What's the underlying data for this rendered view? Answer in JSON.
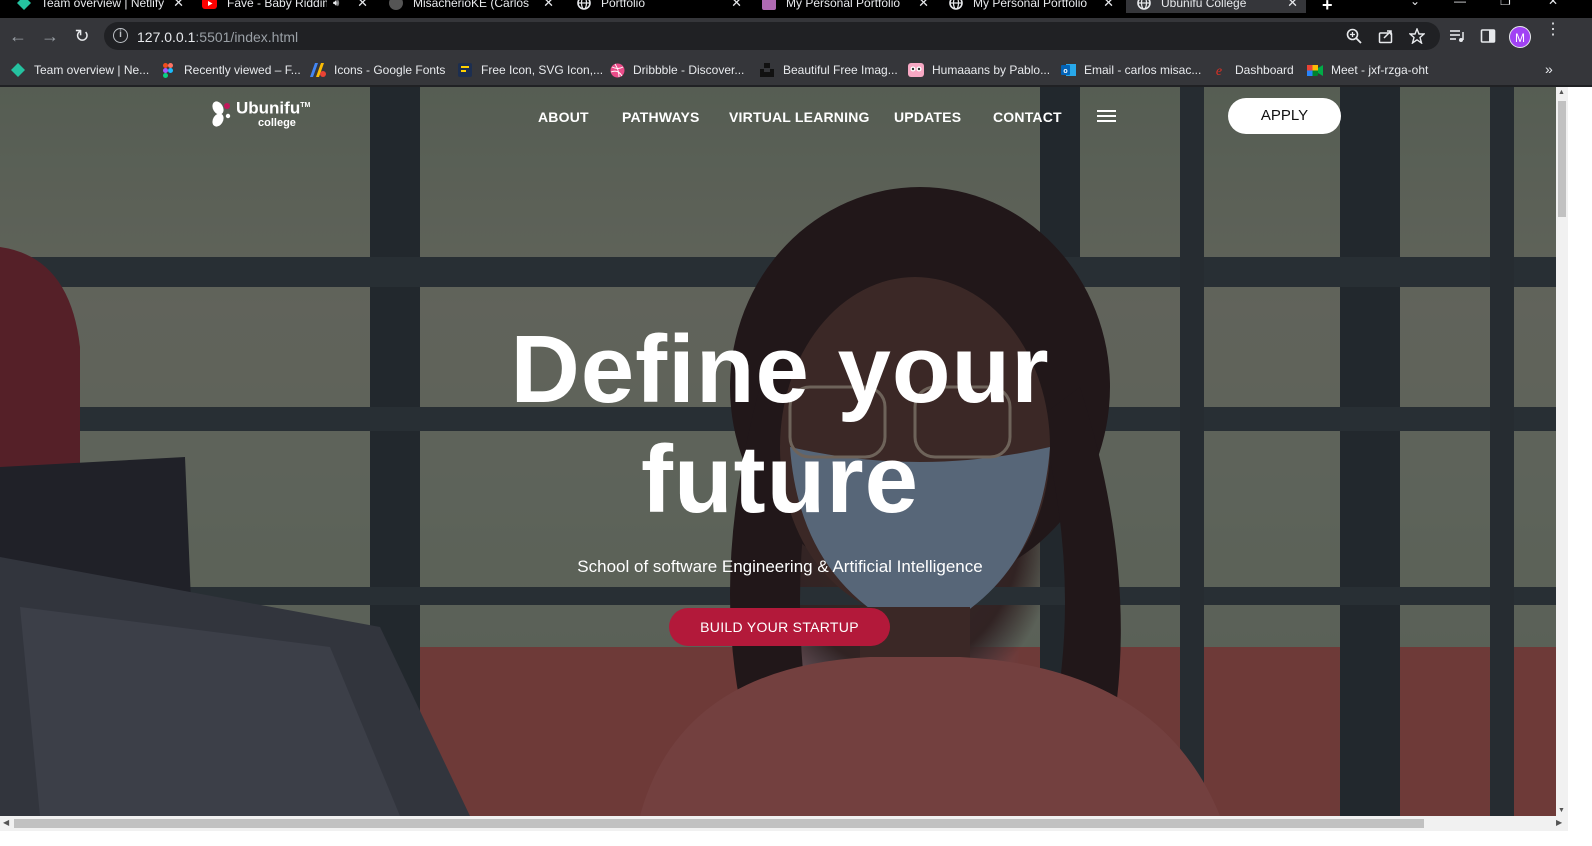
{
  "browser": {
    "tabs": [
      {
        "title": "Team overview | Netlify",
        "favicon": "netlify-icon"
      },
      {
        "title": "Fave - Baby Riddim",
        "favicon": "youtube-icon"
      },
      {
        "title": "MisacherioKE (Carlos M",
        "favicon": "github-icon"
      },
      {
        "title": "Portfolio",
        "favicon": "globe-icon"
      },
      {
        "title": "My Personal Portfolio",
        "favicon": "portfolio-icon"
      },
      {
        "title": "My Personal Portfolio",
        "favicon": "globe-icon"
      },
      {
        "title": "Ubunifu College",
        "favicon": "globe-icon",
        "active": true
      }
    ],
    "url_host": "127.0.0.1",
    "url_rest": ":5501/index.html",
    "profile_initial": "M",
    "bookmarks": [
      {
        "label": "Team overview | Ne...",
        "favicon": "netlify-icon"
      },
      {
        "label": "Recently viewed – F...",
        "favicon": "figma-icon"
      },
      {
        "label": "Icons - Google Fonts",
        "favicon": "google-fonts-icon"
      },
      {
        "label": "Free Icon, SVG Icon,...",
        "favicon": "flaticon-icon"
      },
      {
        "label": "Dribbble - Discover...",
        "favicon": "dribbble-icon"
      },
      {
        "label": "Beautiful Free Imag...",
        "favicon": "unsplash-icon"
      },
      {
        "label": "Humaaans by Pablo...",
        "favicon": "humaaans-icon"
      },
      {
        "label": "Email - carlos misac...",
        "favicon": "outlook-icon"
      },
      {
        "label": "Dashboard",
        "favicon": "dashboard-icon"
      },
      {
        "label": "Meet - jxf-rzga-oht",
        "favicon": "google-meet-icon"
      }
    ]
  },
  "site": {
    "logo_text": "Ubunifu",
    "logo_sub": "college",
    "logo_tm": "TM",
    "nav": {
      "about": "ABOUT",
      "pathways": "PATHWAYS",
      "virtual_learning": "VIRTUAL LEARNING",
      "updates": "UPDATES",
      "contact": "CONTACT"
    },
    "apply_label": "APPLY",
    "hero": {
      "headline_line1": "Define your",
      "headline_line2": "future",
      "subline": "School of software Engineering & Artificial Intelligence",
      "cta_label": "BUILD YOUR STARTUP"
    },
    "colors": {
      "cta": "#b3193a",
      "apply_bg": "#ffffff",
      "logo_accent": "#c2185b"
    }
  }
}
